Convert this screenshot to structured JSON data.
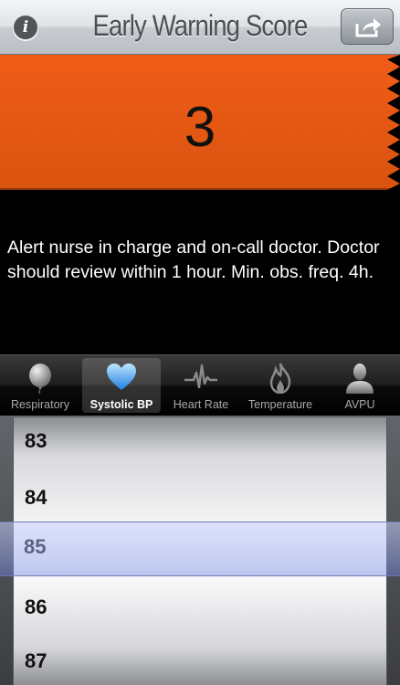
{
  "navbar": {
    "info_glyph": "i",
    "title": "Early Warning Score",
    "share_icon": "share-icon"
  },
  "score": {
    "value": "3",
    "color": "#e8581a"
  },
  "message": "Alert nurse in charge and on-call doctor. Doctor should review within 1 hour. Min. obs. freq. 4h.",
  "tabs": [
    {
      "label": "Respiratory",
      "icon": "balloon-icon",
      "active": false
    },
    {
      "label": "Systolic BP",
      "icon": "heart-icon",
      "active": true
    },
    {
      "label": "Heart Rate",
      "icon": "pulse-icon",
      "active": false
    },
    {
      "label": "Temperature",
      "icon": "flame-icon",
      "active": false
    },
    {
      "label": "AVPU",
      "icon": "person-icon",
      "active": false
    }
  ],
  "picker": {
    "values": [
      "83",
      "84",
      "85",
      "86",
      "87"
    ],
    "selected": "85"
  }
}
